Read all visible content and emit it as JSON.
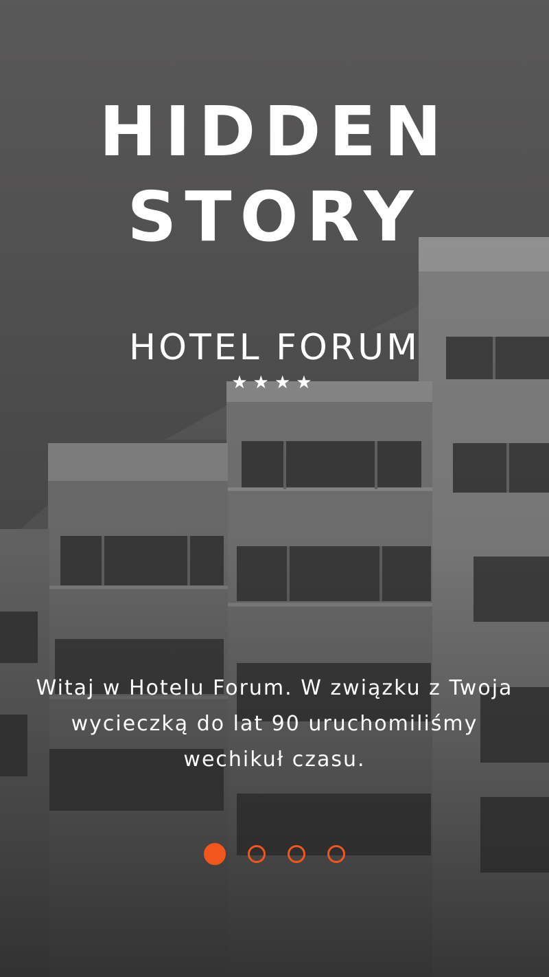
{
  "onboarding": {
    "title_line1": "HIDDEN",
    "title_line2": "STORY",
    "hotel_name": "HOTEL FORUM",
    "stars": "★★★★",
    "rating_stars": 4,
    "welcome_text": "Witaj w Hotelu Forum. W związku z Twoja wycieczką do lat 90 uruchomiliśmy wechikuł czasu.",
    "accent_color": "#f2561d",
    "background_image": "building-photo",
    "pager": {
      "total_pages": 4,
      "current_page": 1
    }
  }
}
